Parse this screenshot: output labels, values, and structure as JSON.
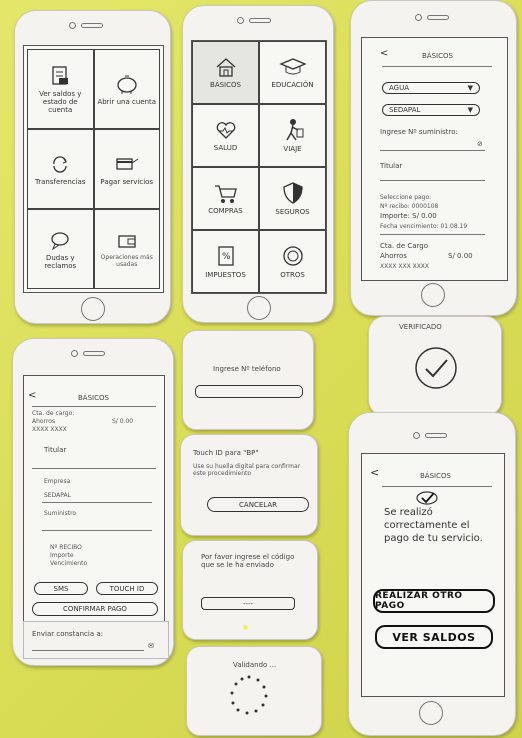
{
  "phone1": {
    "items": [
      {
        "icon": "document-icon",
        "label": "Ver saldos y estado de cuenta"
      },
      {
        "icon": "piggy-bank-icon",
        "label": "Abrir una cuenta"
      },
      {
        "icon": "refresh-icon",
        "label": "Transferencias"
      },
      {
        "icon": "card-payment-icon",
        "label": "Pagar servicios"
      },
      {
        "icon": "chat-bubble-icon",
        "label": "Dudas y reclamos"
      },
      {
        "icon": "wallet-icon",
        "label": "Operaciones más usadas"
      }
    ]
  },
  "phone2": {
    "back": "<",
    "items": [
      {
        "icon": "house-icon",
        "label": "BÁSICOS"
      },
      {
        "icon": "graduation-cap-icon",
        "label": "EDUCACIÓN"
      },
      {
        "icon": "heart-pulse-icon",
        "label": "SALUD"
      },
      {
        "icon": "traveler-icon",
        "label": "VIAJE"
      },
      {
        "icon": "cart-icon",
        "label": "COMPRAS"
      },
      {
        "icon": "shield-icon",
        "label": "SEGUROS"
      },
      {
        "icon": "percent-doc-icon",
        "label": "IMPUESTOS"
      },
      {
        "icon": "other-circle-icon",
        "label": "OTROS"
      }
    ]
  },
  "phone3": {
    "back": "<",
    "title": "BÁSICOS",
    "select1": "AGUA",
    "select2": "SEDAPAL",
    "suministro_label": "Ingrese Nº suministro:",
    "titular_label": "Titular",
    "recibo_label": "Seleccione pago:",
    "recibo_num": "Nº recibo: 0000108",
    "importe": "Importe: S/ 0.00",
    "vencimiento": "Fecha vencimiento: 01.08.19",
    "cuenta_label": "Cta. de Cargo",
    "cuenta_name": "Ahorros",
    "cuenta_amount": "S/ 0.00",
    "cuenta_num": "XXXX XXX XXXX"
  },
  "phone4": {
    "back": "<",
    "title": "BÁSICOS",
    "cuenta_label": "Cta. de cargo:",
    "cuenta_name": "Ahorros",
    "cuenta_amount": "S/ 0.00",
    "cuenta_num": "XXXX XXXX",
    "titular_label": "Titular",
    "empresa_label": "Empresa",
    "empresa_value": "SEDAPAL",
    "suministro_label": "Suministro",
    "recibo_label": "Nº RECIBO",
    "importe_label": "Importe",
    "vencimiento_label": "Vencimiento",
    "sms_button": "SMS",
    "touch_button": "TOUCH ID",
    "confirm_button": "CONFIRMAR PAGO",
    "email_label": "Enviar constancia a:"
  },
  "card_telefono": {
    "title": "Ingrese Nº teléfono"
  },
  "card_touch": {
    "title": "Touch ID para \"BP\"",
    "body": "Use su huella digital para confirmar este procedimiento",
    "cancel": "CANCELAR"
  },
  "card_codigo": {
    "body": "Por favor ingrese el código que se le ha enviado",
    "field": "----"
  },
  "card_validando": {
    "title": "Validando ..."
  },
  "card_verificado": {
    "title": "VERIFICADO"
  },
  "phone5": {
    "back": "<",
    "title": "BÁSICOS",
    "message": "Se realizó correctamente el pago de tu servicio.",
    "button1": "REALIZAR OTRO PAGO",
    "button2": "VER SALDOS"
  },
  "colors": {
    "background": "#dcdf58",
    "paper": "#f4f3ef",
    "ink": "#333333"
  }
}
